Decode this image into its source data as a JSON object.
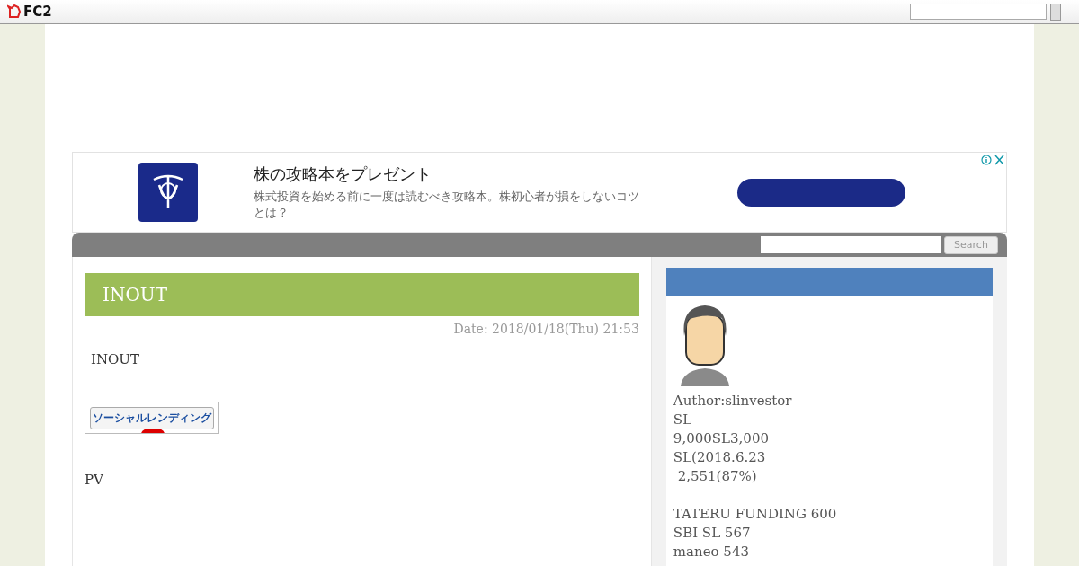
{
  "topbar": {
    "logo": "FC2"
  },
  "ad": {
    "headline": "株の攻略本をプレゼント",
    "description": "株式投資を始める前に一度は読むべき攻略本。株初心者が損をしないコツとは？"
  },
  "navbar": {
    "search_button": "Search"
  },
  "entry": {
    "title": "INOUT",
    "date": "Date: 2018/01/18(Thu) 21:53",
    "paragraphs": [
      "INOUT"
    ],
    "banner": "ソーシャルレンディング",
    "footer": "PV"
  },
  "sidebar": {
    "author": "Author:slinvestor",
    "lines": [
      "SL",
      "9,000SL3,000",
      "SL(2018.6.23",
      " 2,551(87%)"
    ],
    "platforms": [
      "TATERU FUNDING 600",
      "SBI SL 567",
      "maneo 543"
    ]
  }
}
